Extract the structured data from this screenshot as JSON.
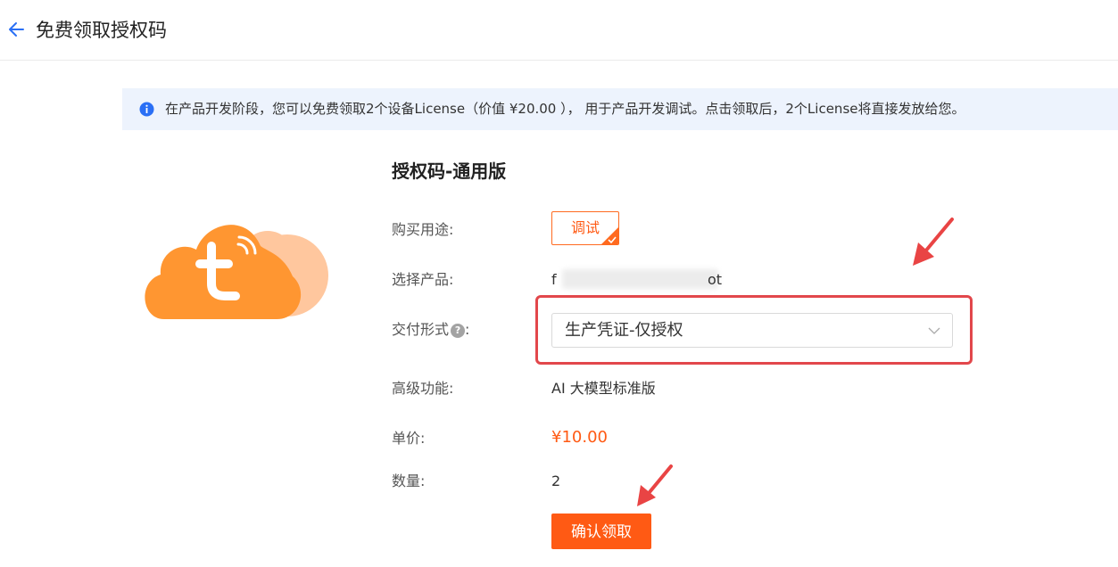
{
  "header": {
    "title": "免费领取授权码"
  },
  "notice": {
    "text": "在产品开发阶段，您可以免费领取2个设备License（价值 ¥20.00 ）， 用于产品开发调试。点击领取后，2个License将直接发放给您。"
  },
  "product": {
    "title": "授权码-通用版"
  },
  "form": {
    "purpose": {
      "label": "购买用途:",
      "option": "调试"
    },
    "product": {
      "label": "选择产品:",
      "value_start": "f",
      "value_end": "ot"
    },
    "delivery": {
      "label": "交付形式",
      "label_suffix": ":",
      "help_icon_text": "?",
      "selected": "生产凭证-仅授权"
    },
    "advanced": {
      "label": "高级功能:",
      "value": "AI 大模型标准版"
    },
    "unit_price": {
      "label": "单价:",
      "value": "¥10.00"
    },
    "quantity": {
      "label": "数量:",
      "value": "2"
    }
  },
  "actions": {
    "confirm_label": "确认领取"
  },
  "colors": {
    "accent": "#ff5a14",
    "highlight": "#e2474b",
    "notice_bg": "#edf3fd",
    "info_icon": "#2a6ff5",
    "logo_primary": "#ff9631",
    "logo_secondary": "#ffc79e"
  },
  "icons": {
    "back": "arrow-left-icon",
    "info": "info-icon",
    "logo": "tuya-cloud-logo",
    "check": "check-icon",
    "dropdown": "chevron-down-icon",
    "help": "question-icon"
  }
}
